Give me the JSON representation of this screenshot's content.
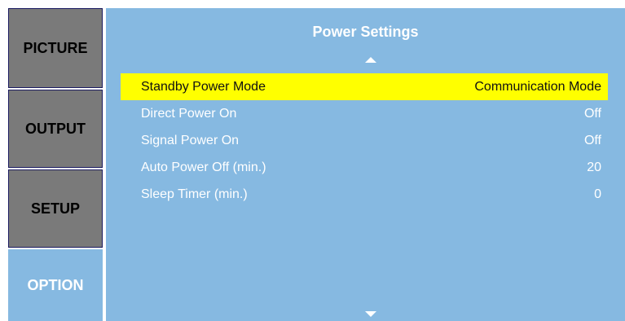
{
  "sidebar": {
    "tabs": [
      {
        "label": "PICTURE",
        "active": false
      },
      {
        "label": "OUTPUT",
        "active": false
      },
      {
        "label": "SETUP",
        "active": false
      },
      {
        "label": "OPTION",
        "active": true
      }
    ]
  },
  "panel": {
    "title": "Power Settings",
    "rows": [
      {
        "label": "Standby Power Mode",
        "value": "Communication Mode",
        "selected": true
      },
      {
        "label": "Direct Power On",
        "value": "Off",
        "selected": false
      },
      {
        "label": "Signal Power On",
        "value": "Off",
        "selected": false
      },
      {
        "label": "Auto Power Off (min.)",
        "value": "20",
        "selected": false
      },
      {
        "label": "Sleep Timer (min.)",
        "value": "0",
        "selected": false
      }
    ]
  },
  "colors": {
    "panel_background": "#86b9e1",
    "inactive_tab": "#7a7a7a",
    "highlight": "#ffff00"
  },
  "icons": {
    "scroll_up": "triangle-up-icon",
    "scroll_down": "triangle-down-icon"
  }
}
